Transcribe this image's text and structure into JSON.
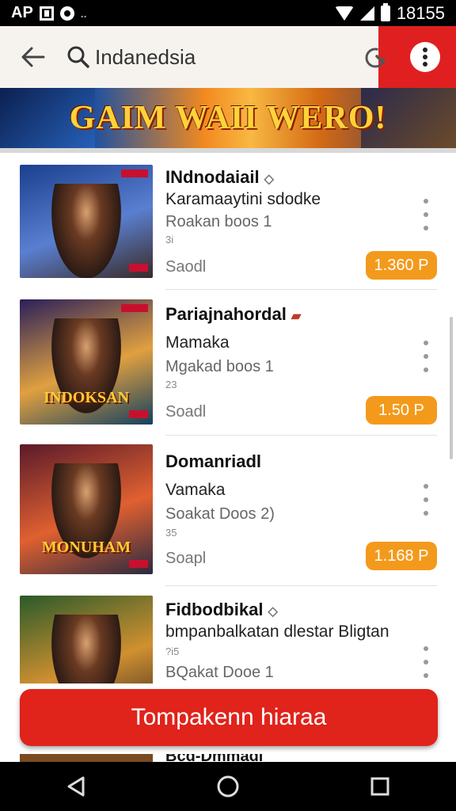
{
  "status_bar": {
    "left_text": "AP",
    "dots": "..",
    "time": "18155"
  },
  "app_bar": {
    "search_text": "Indanedsia",
    "icons": [
      "arrow-back-icon",
      "search-icon",
      "refresh-icon",
      "more-vertical-icon"
    ]
  },
  "banner": {
    "title": "GAIM WAII WERO!"
  },
  "items": [
    {
      "title": "INdnodaiail",
      "subtitle": "Karamaaytini sdodke",
      "meta": "Roakan boos  1",
      "small": "3i",
      "status": "Saodl",
      "price": "1.360 P",
      "logo": "",
      "colors": [
        "#1b3f8f",
        "#5a7fd0",
        "#3a2a24"
      ]
    },
    {
      "title": "Pariajnahordal",
      "subtitle": "Mamaka",
      "meta": "Mgakad boos  1",
      "small": "23",
      "status": "Soadl",
      "price": "1.50 P",
      "logo": "INDOKSAN",
      "colors": [
        "#2a1f5a",
        "#e0a040",
        "#144060"
      ]
    },
    {
      "title": "Domanriadl",
      "subtitle": "Vamaka",
      "meta": "Soakat Doos  2)",
      "small": "35",
      "status": "Soapl",
      "price": "1.168 P",
      "logo": "MONUHAM",
      "colors": [
        "#5a1a2a",
        "#e06030",
        "#2a2a40"
      ]
    },
    {
      "title": "Fidbodbikal",
      "subtitle": "bmpanbalkatan dlestar Bligtan",
      "meta": "BQakat Dooe  1",
      "small": "?i5",
      "status": "",
      "price": "",
      "logo": "",
      "colors": [
        "#2a5a2a",
        "#d09030",
        "#3a2a20"
      ]
    }
  ],
  "cta": {
    "label": "Tompakenn hiaraa"
  },
  "peek": {
    "title": "Bcd-Dmmadi"
  },
  "nav": {
    "icons": [
      "back-triangle-icon",
      "home-circle-icon",
      "recents-square-icon"
    ]
  }
}
